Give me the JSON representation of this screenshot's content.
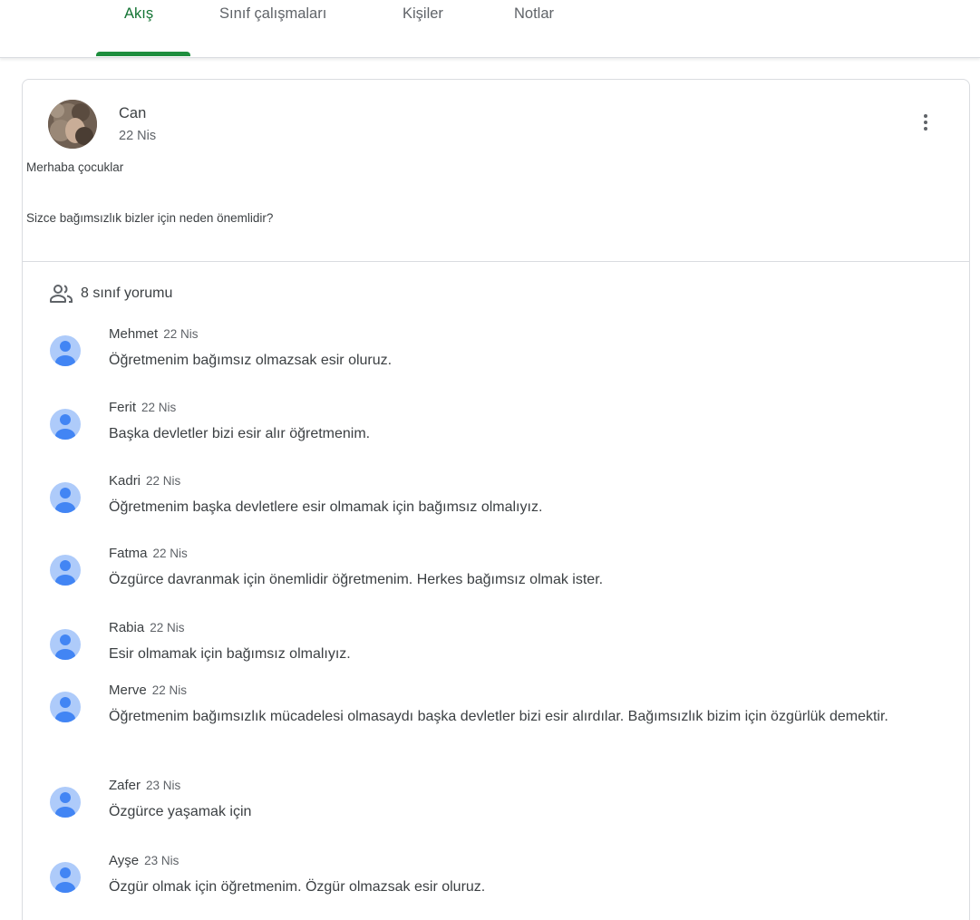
{
  "tabs": [
    {
      "label": "Akış"
    },
    {
      "label": "Sınıf çalışmaları"
    },
    {
      "label": "Kişiler"
    },
    {
      "label": "Notlar"
    }
  ],
  "post": {
    "author": "Can",
    "date": "22 Nis",
    "line1": "Merhaba çocuklar",
    "line2": "Sizce bağımsızlık bizler için neden önemlidir?"
  },
  "comment_count_label": "8 sınıf yorumu",
  "comments": [
    {
      "name": "Mehmet",
      "date": "22 Nis",
      "text": "Öğretmenim bağımsız olmazsak esir oluruz."
    },
    {
      "name": "Ferit",
      "date": "22 Nis",
      "text": "Başka devletler bizi esir alır öğretmenim."
    },
    {
      "name": "Kadri",
      "date": "22 Nis",
      "text": "Öğretmenim başka devletlere esir olmamak için bağımsız olmalıyız."
    },
    {
      "name": "Fatma",
      "date": "22 Nis",
      "text": "Özgürce davranmak için önemlidir öğretmenim. Herkes bağımsız olmak ister."
    },
    {
      "name": "Rabia",
      "date": "22 Nis",
      "text": "Esir olmamak için bağımsız olmalıyız."
    },
    {
      "name": "Merve",
      "date": "22 Nis",
      "text": "Öğretmenim bağımsızlık mücadelesi olmasaydı başka devletler bizi esir alırdılar. Bağımsızlık bizim için özgürlük demektir."
    },
    {
      "name": "Zafer",
      "date": "23 Nis",
      "text": "Özgürce yaşamak için"
    },
    {
      "name": "Ayşe",
      "date": "23 Nis",
      "text": "Özgür olmak için öğretmenim. Özgür olmazsak esir oluruz."
    }
  ],
  "colors": {
    "accent": "#1e8e3e",
    "avatar_bg": "#aecbfa",
    "avatar_fg": "#4285f4"
  },
  "icons": {
    "people": "people-icon",
    "more": "more-vert-icon",
    "avatar": "account-icon"
  }
}
